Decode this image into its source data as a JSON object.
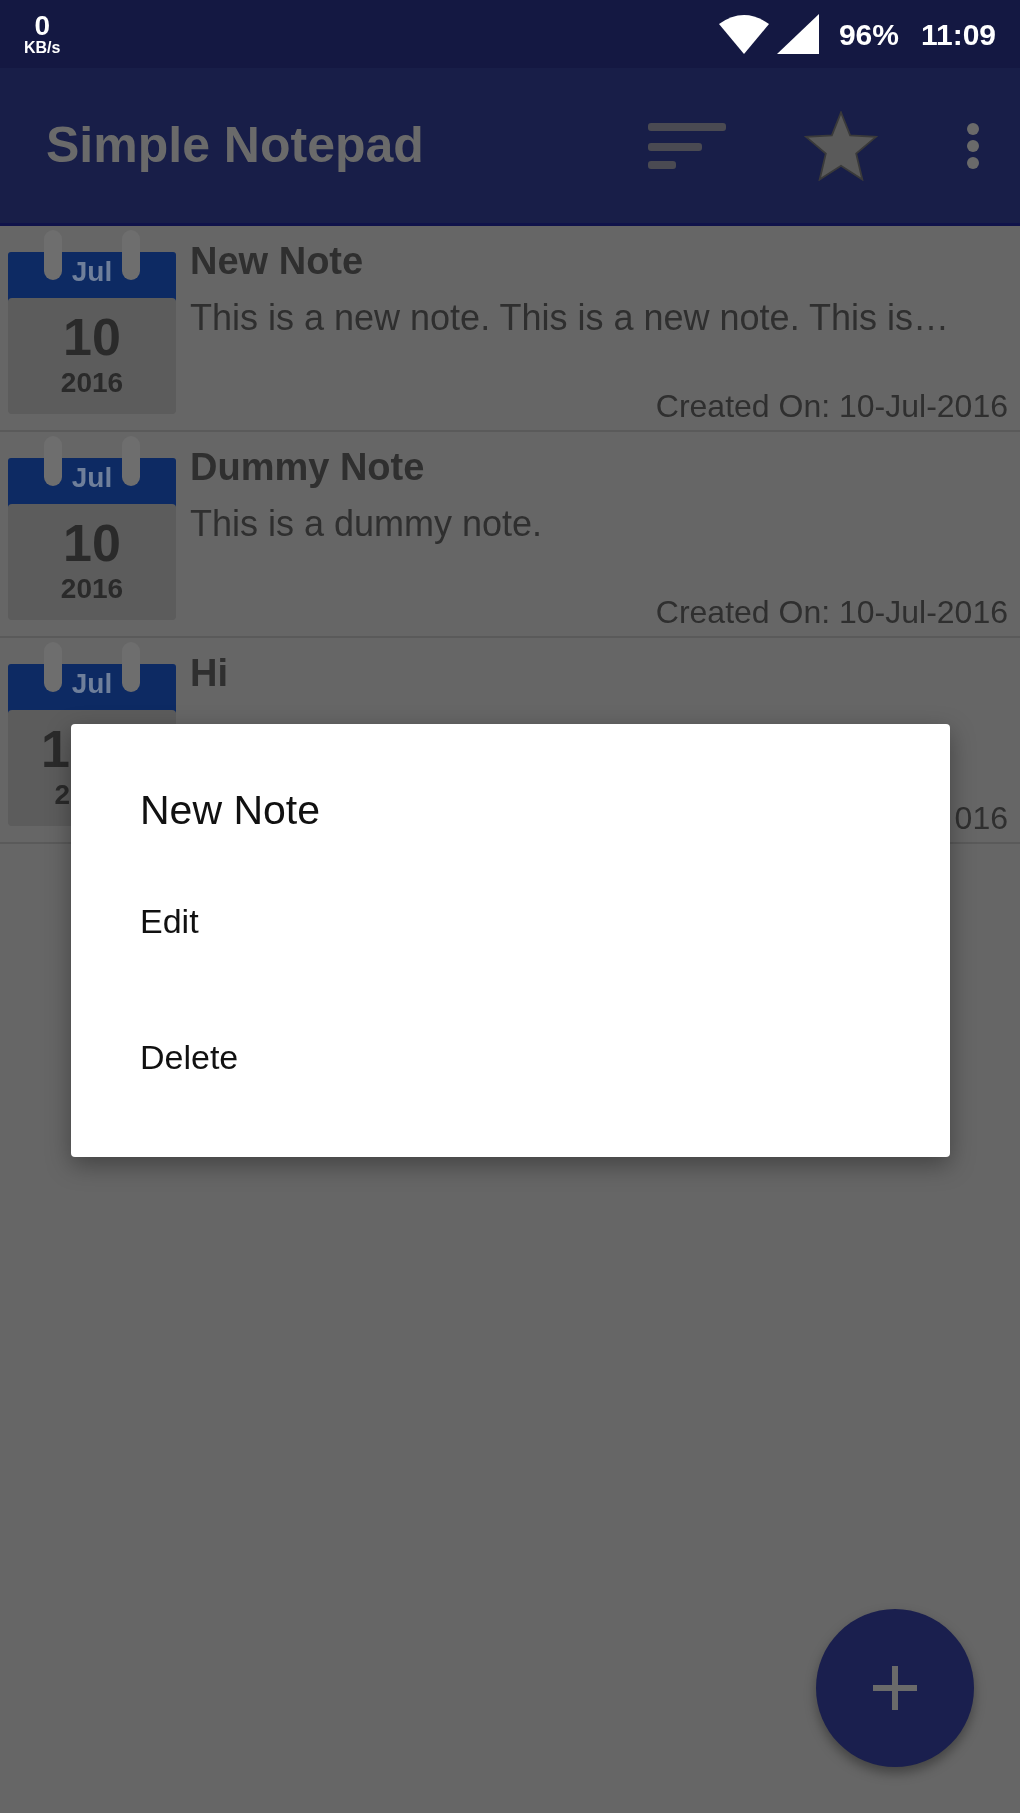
{
  "status_bar": {
    "speed_value": "0",
    "speed_unit": "KB/s",
    "battery": "96%",
    "time": "11:09"
  },
  "app_bar": {
    "title": "Simple Notepad"
  },
  "notes": [
    {
      "month": "Jul",
      "day": "10",
      "year": "2016",
      "title": "New Note",
      "body": "This is a new note. This is a new note. This is…",
      "created": "Created On: 10-Jul-2016",
      "covered": false
    },
    {
      "month": "Jul",
      "day": "10",
      "year": "2016",
      "title": "Dummy Note",
      "body": "This is a dummy note.",
      "created": "Created On: 10-Jul-2016",
      "covered": false
    },
    {
      "month": "Jul",
      "day": "1",
      "year": "2",
      "title": "Hi",
      "created": "016",
      "covered": true
    }
  ],
  "dialog": {
    "title": "New Note",
    "items": [
      "Edit",
      "Delete"
    ]
  }
}
